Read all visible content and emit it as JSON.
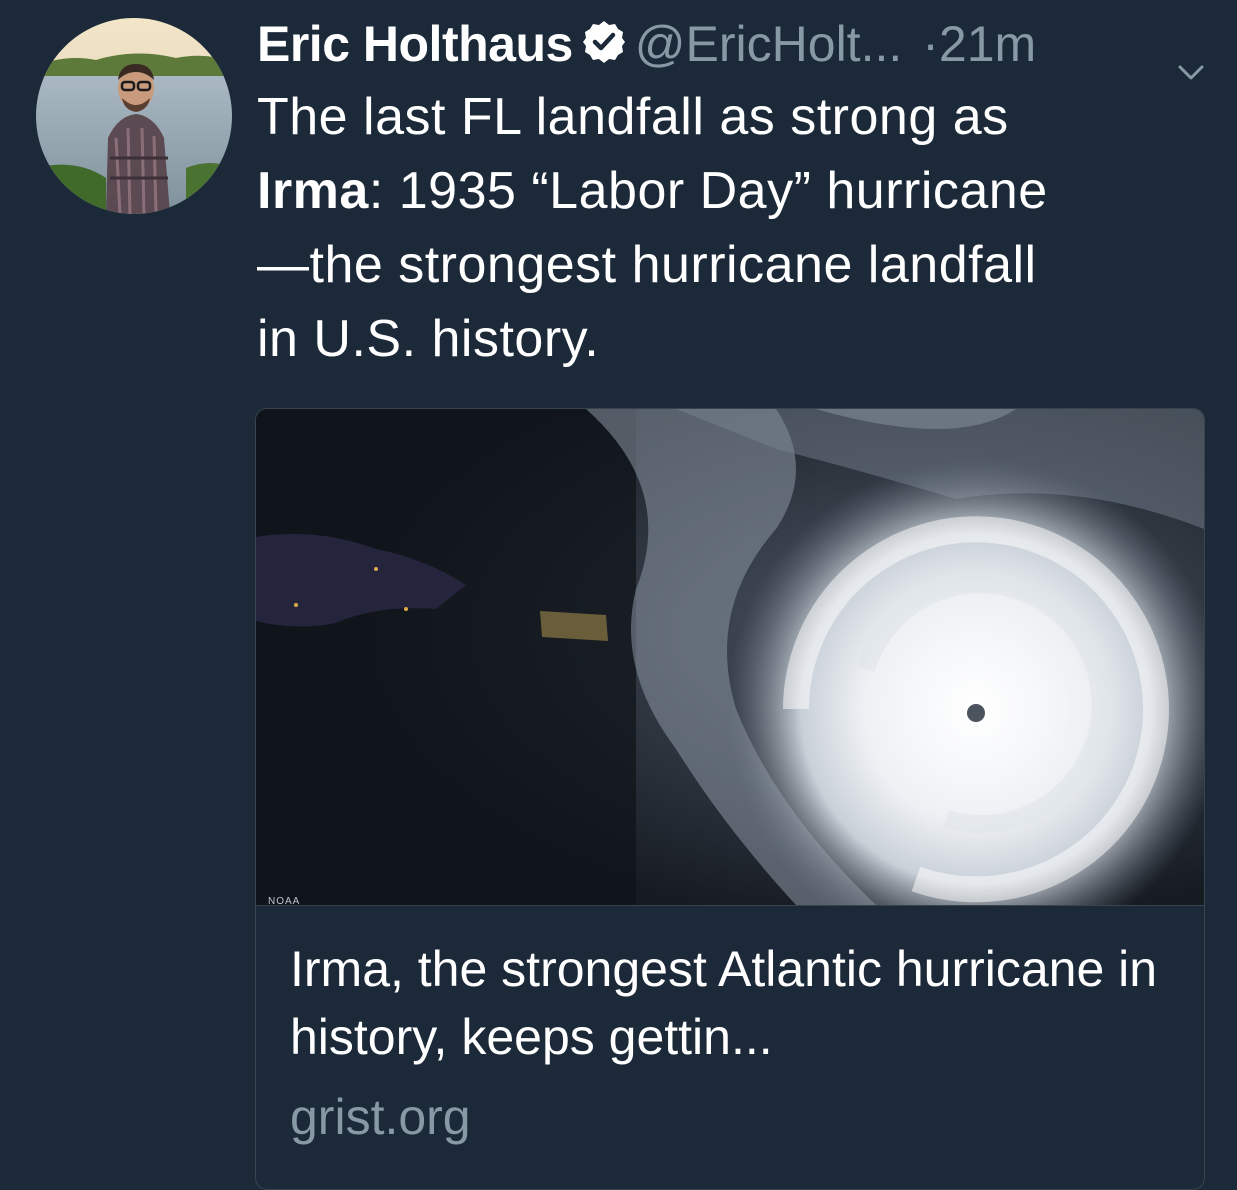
{
  "tweet": {
    "author_name": "Eric Holthaus",
    "handle": "@EricHolt...",
    "dot": "·",
    "time": "21m",
    "text": {
      "line1": "The last FL landfall as strong as",
      "bold": "Irma",
      "line2_rest": ": 1935 “Labor Day” hurricane",
      "line3": "—the strongest hurricane landfall",
      "line4": "in U.S. history."
    }
  },
  "icons": {
    "verified": "verified-badge-icon",
    "menu": "chevron-down-icon"
  },
  "card": {
    "image_credit": "NOAA",
    "title": "Irma, the strongest Atlantic hurricane in history, keeps gettin...",
    "domain": "grist.org"
  },
  "colors": {
    "background": "#1c2938",
    "secondary_text": "#8899a6",
    "border": "#38444d"
  }
}
